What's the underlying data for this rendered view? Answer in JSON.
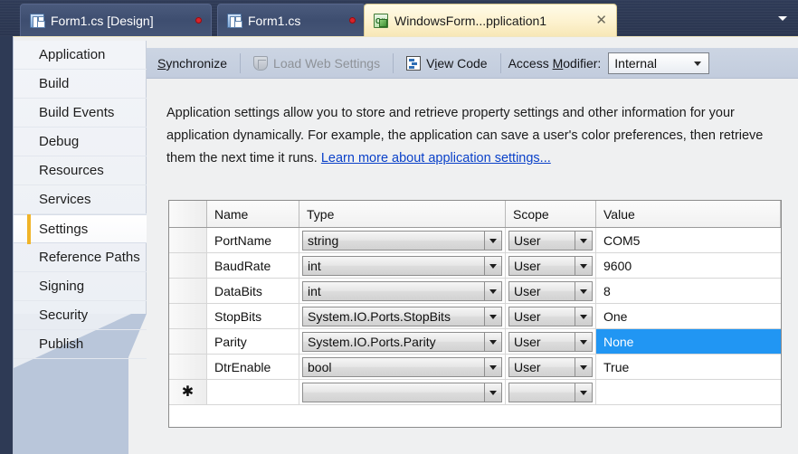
{
  "tabs": [
    {
      "id": "tab-design",
      "label": "Form1.cs [Design]",
      "icon": "form-designer-icon",
      "active": false,
      "dirty": true
    },
    {
      "id": "tab-code",
      "label": "Form1.cs",
      "icon": "form-designer-icon",
      "active": false,
      "dirty": true
    },
    {
      "id": "tab-app",
      "label": "WindowsForm...pplication1",
      "icon": "csharp-project-icon",
      "active": true,
      "dirty": false,
      "close_glyph": "✕"
    }
  ],
  "tabstrip": {
    "overflow_icon": "chevron-down-icon"
  },
  "sidebar": {
    "items": [
      {
        "label": "Application",
        "selected": false
      },
      {
        "label": "Build",
        "selected": false
      },
      {
        "label": "Build Events",
        "selected": false
      },
      {
        "label": "Debug",
        "selected": false
      },
      {
        "label": "Resources",
        "selected": false
      },
      {
        "label": "Services",
        "selected": false
      },
      {
        "label": "Settings",
        "selected": true
      },
      {
        "label": "Reference Paths",
        "selected": false
      },
      {
        "label": "Signing",
        "selected": false
      },
      {
        "label": "Security",
        "selected": false
      },
      {
        "label": "Publish",
        "selected": false
      }
    ]
  },
  "toolbar": {
    "synchronize": {
      "pre": "S",
      "accel": "",
      "label_full": "Synchronize"
    },
    "synchronize_label": "Synchronize",
    "load_web_settings_label": "Load Web Settings",
    "load_web_settings_icon": "shield-icon",
    "view_code_label": "View Code",
    "view_code_icon": "code-window-icon",
    "access_modifier_label": "Access Modifier:",
    "access_modifier_value": "Internal"
  },
  "description": {
    "text": "Application settings allow you to store and retrieve property settings and other information for your application dynamically. For example, the application can save a user's color preferences, then retrieve them the next time it runs. ",
    "link": "Learn more about application settings..."
  },
  "grid": {
    "headers": [
      "",
      "Name",
      "Type",
      "Scope",
      "Value"
    ],
    "new_row_glyph": "✱",
    "rows": [
      {
        "name": "PortName",
        "type": "string",
        "scope": "User",
        "value": "COM5",
        "value_selected": false
      },
      {
        "name": "BaudRate",
        "type": "int",
        "scope": "User",
        "value": "9600",
        "value_selected": false
      },
      {
        "name": "DataBits",
        "type": "int",
        "scope": "User",
        "value": "8",
        "value_selected": false
      },
      {
        "name": "StopBits",
        "type": "System.IO.Ports.StopBits",
        "scope": "User",
        "value": "One",
        "value_selected": false
      },
      {
        "name": "Parity",
        "type": "System.IO.Ports.Parity",
        "scope": "User",
        "value": "None",
        "value_selected": true
      },
      {
        "name": "DtrEnable",
        "type": "bool",
        "scope": "User",
        "value": "True",
        "value_selected": false
      },
      {
        "name": "",
        "type": "",
        "scope": "",
        "value": "",
        "value_selected": false,
        "is_new_row": true
      }
    ]
  },
  "colors": {
    "selection_blue": "#2196f3",
    "active_tab": "#fdf2cf",
    "tabstrip_navy": "#2f3b57",
    "accent_gold": "#f0b429",
    "link_blue": "#0a41c9"
  }
}
